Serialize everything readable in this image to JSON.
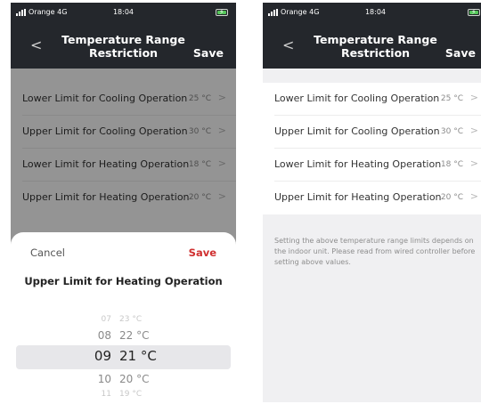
{
  "status_bar": {
    "carrier": "Orange 4G",
    "time": "18:04"
  },
  "nav": {
    "back_icon": "<",
    "title_line1": "Temperature Range",
    "title_line2": "Restriction",
    "save_label": "Save"
  },
  "settings": [
    {
      "label": "Lower Limit for Cooling Operation",
      "value": "25 °C"
    },
    {
      "label": "Upper Limit for Cooling Operation",
      "value": "30 °C"
    },
    {
      "label": "Lower Limit for Heating Operation",
      "value": "18 °C"
    },
    {
      "label": "Upper Limit for Heating Operation",
      "value": "20 °C"
    }
  ],
  "note": "Setting the above temperature range limits depends on the indoor unit. Please read from wired controller before setting above values.",
  "sheet": {
    "cancel_label": "Cancel",
    "save_label": "Save",
    "title": "Upper Limit for Heating Operation",
    "picker": [
      {
        "hour": "07",
        "temp": "23 °C"
      },
      {
        "hour": "08",
        "temp": "22 °C"
      },
      {
        "hour": "09",
        "temp": "21 °C"
      },
      {
        "hour": "10",
        "temp": "20 °C"
      },
      {
        "hour": "11",
        "temp": "19 °C"
      }
    ],
    "selected_index": 2
  },
  "colors": {
    "header": "#24272c",
    "accent_save": "#d03030",
    "background": "#f0f0f2"
  }
}
